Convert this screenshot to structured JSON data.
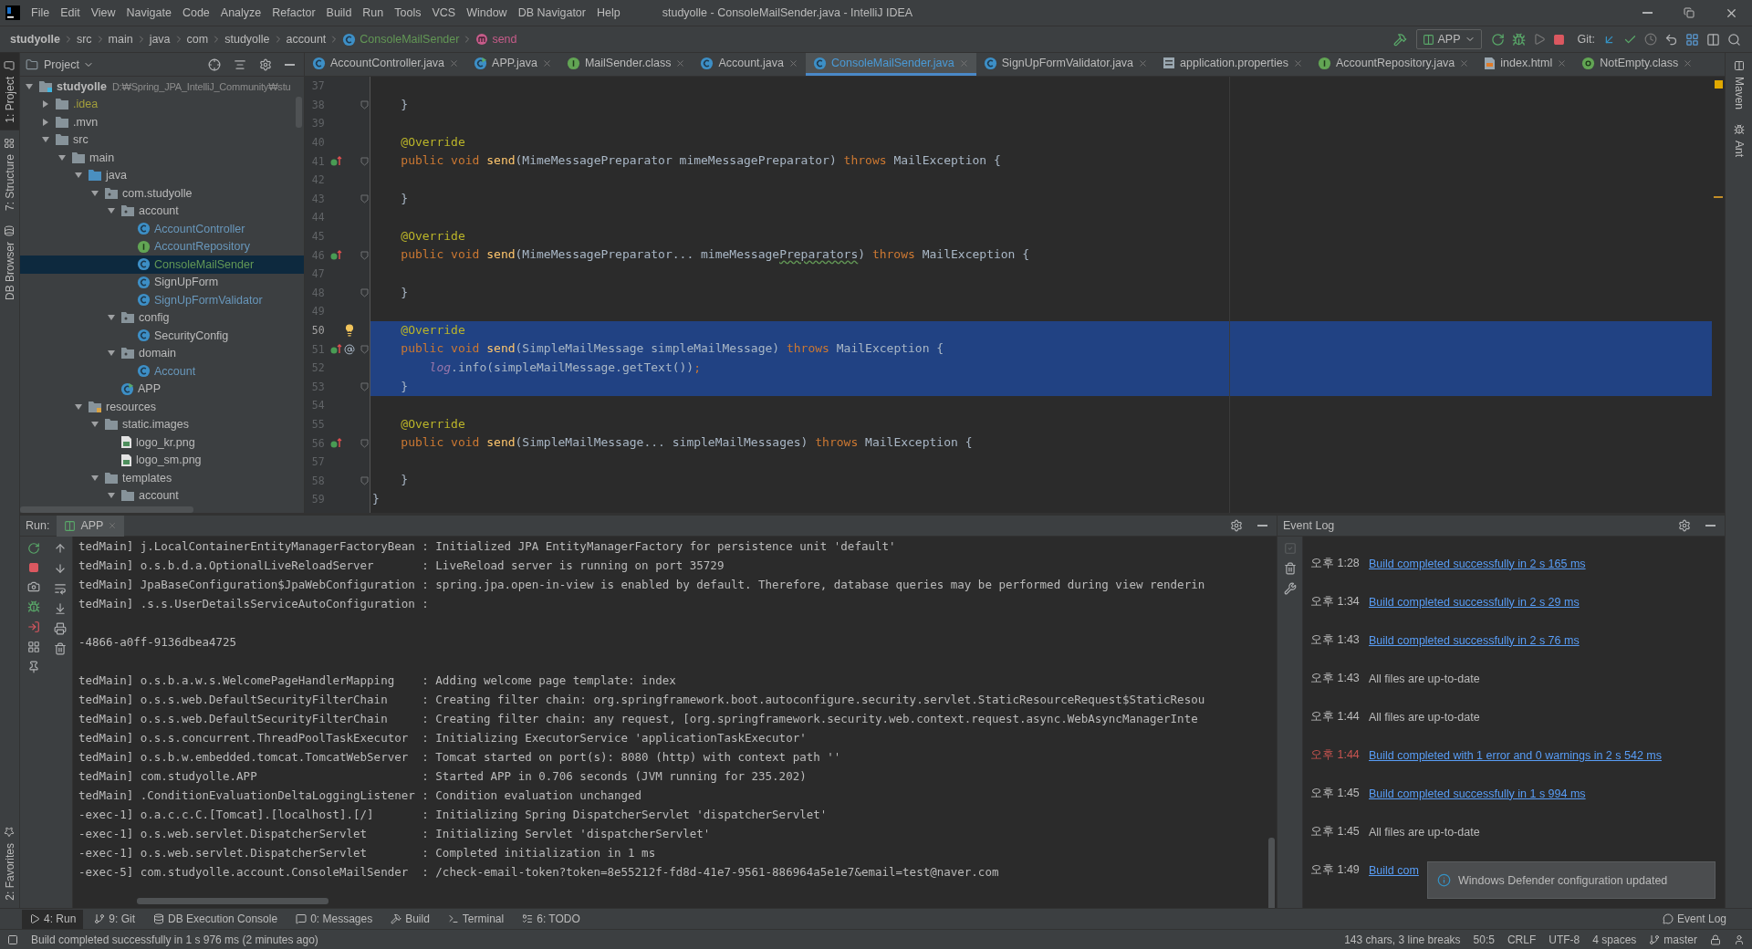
{
  "window": {
    "title": "studyolle - ConsoleMailSender.java - IntelliJ IDEA",
    "menu": [
      "File",
      "Edit",
      "View",
      "Navigate",
      "Code",
      "Analyze",
      "Refactor",
      "Build",
      "Run",
      "Tools",
      "VCS",
      "Window",
      "DB Navigator",
      "Help"
    ]
  },
  "breadcrumbs": [
    {
      "label": "studyolle",
      "kind": "project"
    },
    {
      "label": "src",
      "kind": "folder"
    },
    {
      "label": "main",
      "kind": "folder"
    },
    {
      "label": "java",
      "kind": "folder"
    },
    {
      "label": "com",
      "kind": "folder"
    },
    {
      "label": "studyolle",
      "kind": "folder"
    },
    {
      "label": "account",
      "kind": "folder"
    },
    {
      "label": "ConsoleMailSender",
      "kind": "class"
    },
    {
      "label": "send",
      "kind": "method"
    }
  ],
  "toolbar": {
    "run_config": "APP",
    "git_label": "Git:"
  },
  "left_strip": {
    "top": [
      {
        "label": "1: Project",
        "selected": true
      },
      {
        "label": "7: Structure",
        "selected": false
      },
      {
        "label": "DB Browser",
        "selected": false
      }
    ],
    "bottom": [
      {
        "label": "2: Favorites",
        "selected": false
      }
    ]
  },
  "right_strip": [
    {
      "label": "Maven"
    },
    {
      "label": "Ant"
    }
  ],
  "project": {
    "title": "Project",
    "tree": [
      {
        "name": "studyolle",
        "path": "D:₩Spring_JPA_IntelliJ_Community₩stu",
        "kind": "module",
        "color": "#bbbbbb",
        "selected": false,
        "expanded": true,
        "children": [
          {
            "name": ".idea",
            "kind": "folder",
            "color": "#a39f3c",
            "selected": false,
            "expanded": false
          },
          {
            "name": ".mvn",
            "kind": "folder",
            "color": "#bbbbbb",
            "selected": false,
            "expanded": false
          },
          {
            "name": "src",
            "kind": "folder",
            "color": "#bbbbbb",
            "selected": false,
            "expanded": true,
            "children": [
              {
                "name": "main",
                "kind": "folder",
                "color": "#bbbbbb",
                "selected": false,
                "expanded": true,
                "children": [
                  {
                    "name": "java",
                    "kind": "source",
                    "color": "#bbbbbb",
                    "selected": false,
                    "expanded": true,
                    "children": [
                      {
                        "name": "com.studyolle",
                        "kind": "package",
                        "color": "#bbbbbb",
                        "selected": false,
                        "expanded": true,
                        "children": [
                          {
                            "name": "account",
                            "kind": "package",
                            "color": "#bbbbbb",
                            "selected": false,
                            "expanded": true,
                            "children": [
                              {
                                "name": "AccountController",
                                "kind": "class",
                                "color": "#6897bb",
                                "selected": false
                              },
                              {
                                "name": "AccountRepository",
                                "kind": "interface",
                                "color": "#6897bb",
                                "selected": false
                              },
                              {
                                "name": "ConsoleMailSender",
                                "kind": "class",
                                "color": "#629755",
                                "selected": true
                              },
                              {
                                "name": "SignUpForm",
                                "kind": "class",
                                "color": "#bbbbbb",
                                "selected": false
                              },
                              {
                                "name": "SignUpFormValidator",
                                "kind": "class",
                                "color": "#6897bb",
                                "selected": false
                              }
                            ]
                          },
                          {
                            "name": "config",
                            "kind": "package",
                            "color": "#bbbbbb",
                            "selected": false,
                            "expanded": true,
                            "children": [
                              {
                                "name": "SecurityConfig",
                                "kind": "class",
                                "color": "#bbbbbb",
                                "selected": false
                              }
                            ]
                          },
                          {
                            "name": "domain",
                            "kind": "package",
                            "color": "#bbbbbb",
                            "selected": false,
                            "expanded": true,
                            "children": [
                              {
                                "name": "Account",
                                "kind": "class",
                                "color": "#6897bb",
                                "selected": false
                              }
                            ]
                          },
                          {
                            "name": "APP",
                            "kind": "app",
                            "color": "#bbbbbb",
                            "selected": false
                          }
                        ]
                      }
                    ]
                  },
                  {
                    "name": "resources",
                    "kind": "resources",
                    "color": "#bbbbbb",
                    "selected": false,
                    "expanded": true,
                    "children": [
                      {
                        "name": "static.images",
                        "kind": "folder",
                        "color": "#bbbbbb",
                        "selected": false,
                        "expanded": true,
                        "children": [
                          {
                            "name": "logo_kr.png",
                            "kind": "image",
                            "color": "#bbbbbb",
                            "selected": false
                          },
                          {
                            "name": "logo_sm.png",
                            "kind": "image",
                            "color": "#bbbbbb",
                            "selected": false
                          }
                        ]
                      },
                      {
                        "name": "templates",
                        "kind": "folder",
                        "color": "#bbbbbb",
                        "selected": false,
                        "expanded": true,
                        "children": [
                          {
                            "name": "account",
                            "kind": "folder",
                            "color": "#bbbbbb",
                            "selected": false,
                            "expanded": true
                          }
                        ]
                      }
                    ]
                  }
                ]
              }
            ]
          }
        ]
      }
    ]
  },
  "editor": {
    "tabs": [
      {
        "label": "AccountController.java",
        "kind": "class",
        "selected": false
      },
      {
        "label": "APP.java",
        "kind": "app",
        "selected": false
      },
      {
        "label": "MailSender.class",
        "kind": "interface",
        "selected": false
      },
      {
        "label": "Account.java",
        "kind": "class",
        "selected": false
      },
      {
        "label": "ConsoleMailSender.java",
        "kind": "class",
        "selected": true
      },
      {
        "label": "SignUpFormValidator.java",
        "kind": "class",
        "selected": false
      },
      {
        "label": "application.properties",
        "kind": "properties",
        "selected": false
      },
      {
        "label": "AccountRepository.java",
        "kind": "interface",
        "selected": false
      },
      {
        "label": "index.html",
        "kind": "html",
        "selected": false
      },
      {
        "label": "NotEmpty.class",
        "kind": "annotation",
        "selected": false
      }
    ],
    "lines": [
      {
        "number": "37",
        "selected": false,
        "fold": false,
        "override": false
      },
      {
        "number": "38",
        "selected": false,
        "fold": true,
        "override": false,
        "tokens": [
          {
            "kind": "plain",
            "text": "    }"
          }
        ]
      },
      {
        "number": "39",
        "selected": false,
        "fold": false,
        "override": false
      },
      {
        "number": "40",
        "selected": false,
        "fold": false,
        "override": false,
        "tokens": [
          {
            "kind": "annotation",
            "text": "    @Override"
          }
        ]
      },
      {
        "number": "41",
        "selected": false,
        "fold": true,
        "override": true,
        "tokens": [
          {
            "kind": "keyword",
            "text": "    public void "
          },
          {
            "kind": "method",
            "text": "send"
          },
          {
            "kind": "plain",
            "text": "(MimeMessagePreparator mimeMessagePreparator) "
          },
          {
            "kind": "keyword",
            "text": "throws "
          },
          {
            "kind": "plain",
            "text": "MailException {"
          }
        ]
      },
      {
        "number": "42",
        "selected": false,
        "fold": false,
        "override": false
      },
      {
        "number": "43",
        "selected": false,
        "fold": true,
        "override": false,
        "tokens": [
          {
            "kind": "plain",
            "text": "    }"
          }
        ]
      },
      {
        "number": "44",
        "selected": false,
        "fold": false,
        "override": false
      },
      {
        "number": "45",
        "selected": false,
        "fold": false,
        "override": false,
        "tokens": [
          {
            "kind": "annotation",
            "text": "    @Override"
          }
        ]
      },
      {
        "number": "46",
        "selected": false,
        "fold": true,
        "override": true,
        "tokens": [
          {
            "kind": "keyword",
            "text": "    public void "
          },
          {
            "kind": "method",
            "text": "send"
          },
          {
            "kind": "plain",
            "text": "(MimeMessagePreparator... mimeMessage"
          },
          {
            "kind": "typo",
            "text": "Preparators"
          },
          {
            "kind": "plain",
            "text": ") "
          },
          {
            "kind": "keyword",
            "text": "throws "
          },
          {
            "kind": "plain",
            "text": "MailException {"
          }
        ]
      },
      {
        "number": "47",
        "selected": false,
        "fold": false,
        "override": false
      },
      {
        "number": "48",
        "selected": false,
        "fold": true,
        "override": false,
        "tokens": [
          {
            "kind": "plain",
            "text": "    }"
          }
        ]
      },
      {
        "number": "49",
        "selected": false,
        "fold": false,
        "override": false
      },
      {
        "number": "50",
        "selected": true,
        "fold": false,
        "override": false,
        "bulb": true,
        "tokens": [
          {
            "kind": "annotation",
            "text": "    @Override"
          }
        ]
      },
      {
        "number": "51",
        "selected": true,
        "fold": true,
        "override": true,
        "at": true,
        "tokens": [
          {
            "kind": "keyword",
            "text": "    public void "
          },
          {
            "kind": "method",
            "text": "send"
          },
          {
            "kind": "plain",
            "text": "(SimpleMailMessage simpleMailMessage) "
          },
          {
            "kind": "keyword",
            "text": "throws "
          },
          {
            "kind": "plain",
            "text": "MailException {"
          }
        ]
      },
      {
        "number": "52",
        "selected": true,
        "fold": false,
        "override": false,
        "tokens": [
          {
            "kind": "field",
            "text": "        log"
          },
          {
            "kind": "plain",
            "text": ".info(simpleMailMessage.getText())"
          },
          {
            "kind": "keyword",
            "text": ";"
          }
        ]
      },
      {
        "number": "53",
        "selected": true,
        "fold": true,
        "override": false,
        "tokens": [
          {
            "kind": "plain",
            "text": "    }"
          }
        ]
      },
      {
        "number": "54",
        "selected": false,
        "fold": false,
        "override": false
      },
      {
        "number": "55",
        "selected": false,
        "fold": false,
        "override": false,
        "tokens": [
          {
            "kind": "annotation",
            "text": "    @Override"
          }
        ]
      },
      {
        "number": "56",
        "selected": false,
        "fold": true,
        "override": true,
        "tokens": [
          {
            "kind": "keyword",
            "text": "    public void "
          },
          {
            "kind": "method",
            "text": "send"
          },
          {
            "kind": "plain",
            "text": "(SimpleMailMessage... simpleMailMessages) "
          },
          {
            "kind": "keyword",
            "text": "throws "
          },
          {
            "kind": "plain",
            "text": "MailException {"
          }
        ]
      },
      {
        "number": "57",
        "selected": false,
        "fold": false,
        "override": false
      },
      {
        "number": "58",
        "selected": false,
        "fold": true,
        "override": false,
        "tokens": [
          {
            "kind": "plain",
            "text": "    }"
          }
        ]
      },
      {
        "number": "59",
        "selected": false,
        "fold": false,
        "override": false,
        "tokens": [
          {
            "kind": "plain",
            "text": "}"
          }
        ]
      }
    ]
  },
  "run": {
    "label": "Run:",
    "tab": "APP",
    "console": [
      {
        "text": "tedMain] j.LocalContainerEntityManagerFactoryBean : Initialized JPA EntityManagerFactory for persistence unit 'default'",
        "blank_after": false
      },
      {
        "text": "tedMain] o.s.b.d.a.OptionalLiveReloadServer       : LiveReload server is running on port 35729",
        "blank_after": false
      },
      {
        "text": "tedMain] JpaBaseConfiguration$JpaWebConfiguration : spring.jpa.open-in-view is enabled by default. Therefore, database queries may be performed during view renderin",
        "blank_after": false
      },
      {
        "text": "tedMain] .s.s.UserDetailsServiceAutoConfiguration :",
        "blank_after": true
      },
      {
        "text": "-4866-a0ff-9136dbea4725",
        "blank_after": true
      },
      {
        "text": "tedMain] o.s.b.a.w.s.WelcomePageHandlerMapping    : Adding welcome page template: index",
        "blank_after": false
      },
      {
        "text": "tedMain] o.s.s.web.DefaultSecurityFilterChain     : Creating filter chain: org.springframework.boot.autoconfigure.security.servlet.StaticResourceRequest$StaticResou",
        "blank_after": false
      },
      {
        "text": "tedMain] o.s.s.web.DefaultSecurityFilterChain     : Creating filter chain: any request, [org.springframework.security.web.context.request.async.WebAsyncManagerInte",
        "blank_after": false
      },
      {
        "text": "tedMain] o.s.s.concurrent.ThreadPoolTaskExecutor  : Initializing ExecutorService 'applicationTaskExecutor'",
        "blank_after": false
      },
      {
        "text": "tedMain] o.s.b.w.embedded.tomcat.TomcatWebServer  : Tomcat started on port(s): 8080 (http) with context path ''",
        "blank_after": false
      },
      {
        "text": "tedMain] com.studyolle.APP                        : Started APP in 0.706 seconds (JVM running for 235.202)",
        "blank_after": false
      },
      {
        "text": "tedMain] .ConditionEvaluationDeltaLoggingListener : Condition evaluation unchanged",
        "blank_after": false
      },
      {
        "text": "-exec-1] o.a.c.c.C.[Tomcat].[localhost].[/]       : Initializing Spring DispatcherServlet 'dispatcherServlet'",
        "blank_after": false
      },
      {
        "text": "-exec-1] o.s.web.servlet.DispatcherServlet        : Initializing Servlet 'dispatcherServlet'",
        "blank_after": false
      },
      {
        "text": "-exec-1] o.s.web.servlet.DispatcherServlet        : Completed initialization in 1 ms",
        "blank_after": false
      },
      {
        "text": "-exec-5] com.studyolle.account.ConsoleMailSender  : /check-email-token?token=8e55212f-fd8d-41e7-9561-886964a5e1e7&email=test@naver.com",
        "blank_after": false
      }
    ]
  },
  "event_log": {
    "title": "Event Log",
    "entries": [
      {
        "time": "오후 1:28",
        "message": "Build completed successfully in 2 s 165 ms",
        "kind": "link",
        "error": false
      },
      {
        "time": "오후 1:34",
        "message": "Build completed successfully in 2 s 29 ms",
        "kind": "link",
        "error": false
      },
      {
        "time": "오후 1:43",
        "message": "Build completed successfully in 2 s 76 ms",
        "kind": "link",
        "error": false
      },
      {
        "time": "오후 1:43",
        "message": "All files are up-to-date",
        "kind": "text",
        "error": false
      },
      {
        "time": "오후 1:44",
        "message": "All files are up-to-date",
        "kind": "text",
        "error": false
      },
      {
        "time": "오후 1:44",
        "message": "Build completed with 1 error and 0 warnings in 2 s 542 ms",
        "kind": "link",
        "error": true
      },
      {
        "time": "오후 1:45",
        "message": "Build completed successfully in 1 s 994 ms",
        "kind": "link",
        "error": false
      },
      {
        "time": "오후 1:45",
        "message": "All files are up-to-date",
        "kind": "text",
        "error": false
      },
      {
        "time": "오후 1:49",
        "message": "Build com",
        "kind": "link",
        "error": false
      }
    ],
    "notification": "Windows Defender configuration updated"
  },
  "tool_buttons": [
    {
      "label": "4: Run",
      "kind": "run",
      "selected": true
    },
    {
      "label": "9: Git",
      "kind": "git",
      "selected": false
    },
    {
      "label": "DB Execution Console",
      "kind": "database",
      "selected": false
    },
    {
      "label": "0: Messages",
      "kind": "messages",
      "selected": false
    },
    {
      "label": "Build",
      "kind": "build",
      "selected": false
    },
    {
      "label": "Terminal",
      "kind": "terminal",
      "selected": false
    },
    {
      "label": "6: TODO",
      "kind": "todo",
      "selected": false
    }
  ],
  "event_log_button": "Event Log",
  "status_bar": {
    "message": "Build completed successfully in 1 s 976 ms (2 minutes ago)",
    "items": [
      "143 chars, 3 line breaks",
      "50:5",
      "CRLF",
      "UTF-8",
      "4 spaces"
    ],
    "branch": "master"
  }
}
